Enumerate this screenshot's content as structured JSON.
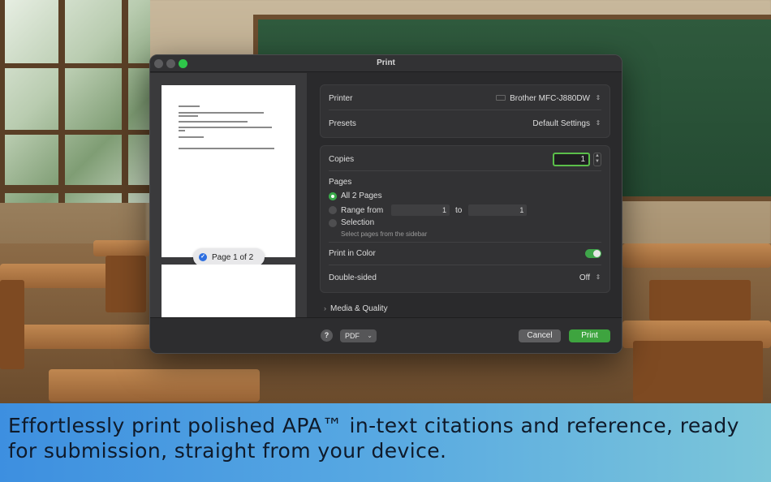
{
  "dialog": {
    "title": "Print",
    "preview": {
      "page_indicator": "Page 1 of 2"
    },
    "printer": {
      "label": "Printer",
      "value": "Brother MFC-J880DW"
    },
    "presets": {
      "label": "Presets",
      "value": "Default Settings"
    },
    "copies": {
      "label": "Copies",
      "value": "1"
    },
    "pages": {
      "label": "Pages",
      "options": {
        "all": "All 2 Pages",
        "range": "Range from",
        "range_to": "to",
        "range_from_value": "1",
        "range_to_value": "1",
        "selection": "Selection",
        "selection_hint": "Select pages from the sidebar"
      },
      "selected": "all"
    },
    "print_in_color": {
      "label": "Print in Color",
      "on": true
    },
    "double_sided": {
      "label": "Double-sided",
      "value": "Off"
    },
    "media_quality": {
      "label": "Media & Quality"
    },
    "footer": {
      "help": "?",
      "pdf": "PDF",
      "cancel": "Cancel",
      "print": "Print"
    }
  },
  "banner": {
    "text": "Effortlessly print polished APA™ in-text citations and reference, ready for submission, straight from your device."
  },
  "colors": {
    "accent_green": "#3ea43f",
    "banner_start": "#3d8fe0",
    "banner_end": "#7cc6d9"
  }
}
